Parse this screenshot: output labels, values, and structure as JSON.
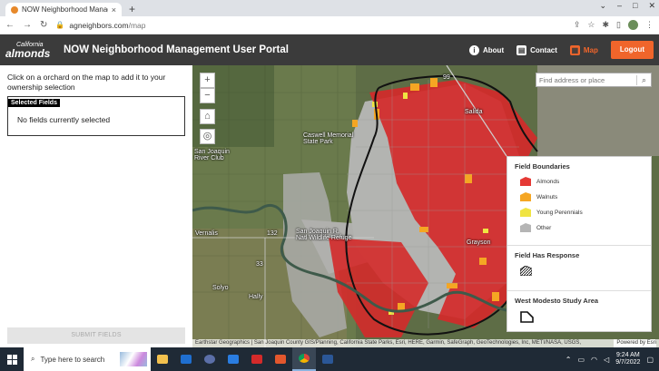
{
  "browser": {
    "tab_title": "NOW Neighborhood Manageme",
    "tab_close": "×",
    "new_tab": "+",
    "window_controls": [
      "⌄",
      "–",
      "□",
      "✕"
    ],
    "url_domain": "agneighbors.com",
    "url_path": "/map"
  },
  "header": {
    "logo_small": "California",
    "logo_big": "almonds",
    "title": "NOW Neighborhood Management User Portal",
    "about_label": "About",
    "contact_label": "Contact",
    "map_label": "Map",
    "logout_label": "Logout"
  },
  "left_panel": {
    "instructions": "Click on a orchard on the map to add it to your ownership selection",
    "selected_header": "Selected Fields",
    "empty_message": "No fields currently selected",
    "submit_label": "SUBMIT FIELDS"
  },
  "map": {
    "search_placeholder": "Find address or place",
    "zoom_in": "+",
    "zoom_out": "−",
    "home": "⌂",
    "locate": "◎",
    "labels": {
      "caswell": "Caswell Memorial\nState Park",
      "river_club": "San Joaquin\nRiver Club",
      "refuge": "San Joaquin R.\nNatl Wildlife Refuge",
      "vernalis": "Vernalis",
      "grayson": "Grayson",
      "salida": "Salida",
      "hally": "Hally",
      "solyo": "Solyo",
      "hwy_99": "99",
      "hwy_132": "132",
      "hwy_33": "33"
    },
    "attribution": "Earthstar Geographics | San Joaquin County GIS/Planning, California State Parks, Esri, HERE, Garmin, SafeGraph, GeoTechnologies, Inc, METI/NASA, USGS,",
    "attribution_right": "Powered by Esri"
  },
  "legend": {
    "title_boundaries": "Field Boundaries",
    "items": [
      {
        "label": "Almonds",
        "color": "#e53935"
      },
      {
        "label": "Walnuts",
        "color": "#f5a623"
      },
      {
        "label": "Young Perennials",
        "color": "#f0e442"
      },
      {
        "label": "Other",
        "color": "#b5b5b5"
      }
    ],
    "title_response": "Field Has Response",
    "title_study": "West Modesto Study Area"
  },
  "taskbar": {
    "search_text": "Type here to search",
    "time": "9:24 AM",
    "date": "9/7/2022"
  }
}
